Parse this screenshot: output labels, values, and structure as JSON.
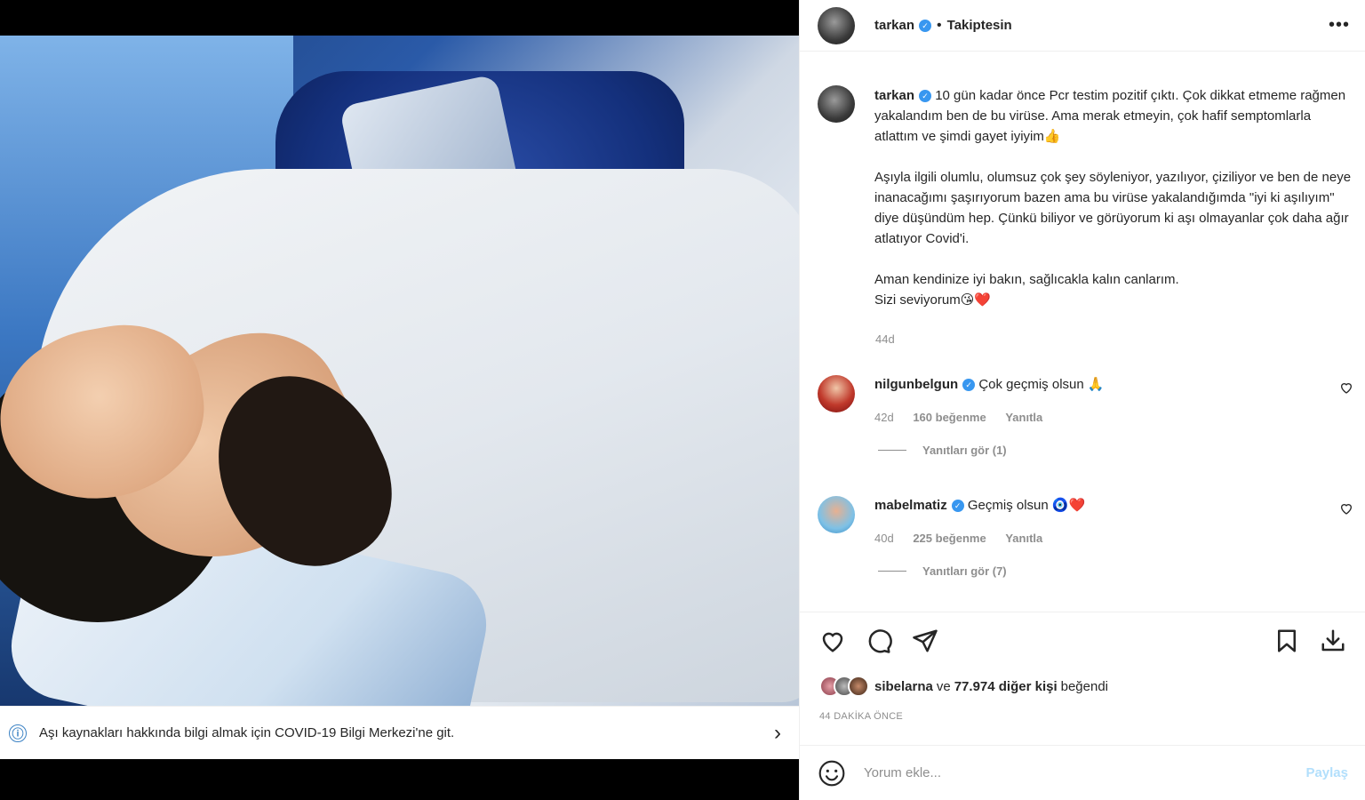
{
  "header": {
    "username": "tarkan",
    "separator": "•",
    "follow_status": "Takiptesin",
    "more": "•••"
  },
  "media": {
    "info_text": "Aşı kaynakları hakkında bilgi almak için COVID-19 Bilgi Merkezi'ne git.",
    "info_icon": "ⓘ",
    "chevron": "›"
  },
  "caption": {
    "username": "tarkan",
    "paragraphs": [
      "10 gün kadar önce Pcr testim pozitif çıktı. Çok dikkat etmeme rağmen yakalandım ben de bu virüse. Ama merak etmeyin, çok hafif semptomlarla atlattım ve şimdi gayet iyiyim👍",
      "Aşıyla ilgili olumlu, olumsuz çok şey söyleniyor, yazılıyor, çiziliyor ve ben de neye inanacağımı şaşırıyorum bazen ama bu virüse yakalandığımda \"iyi ki aşılıyım\" diye düşündüm hep. Çünkü biliyor ve görüyorum ki aşı olmayanlar çok daha ağır atlatıyor Covid'i.",
      "Aman kendinize iyi bakın, sağlıcakla kalın canlarım.",
      "Sizi seviyorum😘❤️"
    ],
    "time": "44d"
  },
  "comments": [
    {
      "username": "nilgunbelgun",
      "text": "Çok geçmiş olsun 🙏",
      "time": "42d",
      "likes": "160 beğenme",
      "reply": "Yanıtla",
      "view_replies": "Yanıtları gör (1)"
    },
    {
      "username": "mabelmatiz",
      "text": "Geçmiş olsun 🧿❤️",
      "time": "40d",
      "likes": "225 beğenme",
      "reply": "Yanıtla",
      "view_replies": "Yanıtları gör (7)"
    }
  ],
  "likes": {
    "first_user": "sibelarna",
    "connector": "ve",
    "others": "77.974 diğer kişi",
    "suffix": "beğendi"
  },
  "timestamp": "44 DAKİKA ÖNCE",
  "add_comment": {
    "placeholder": "Yorum ekle...",
    "post_label": "Paylaş"
  },
  "icons": {
    "like": "heart-icon",
    "comment": "comment-icon",
    "share": "send-icon",
    "save": "bookmark-icon",
    "download": "download-icon",
    "emoji": "smiley-icon"
  },
  "colors": {
    "verified": "#3897f0",
    "muted": "#8e8e8e",
    "post_disabled": "#b2dffc",
    "info_blue": "#3b82c4"
  }
}
